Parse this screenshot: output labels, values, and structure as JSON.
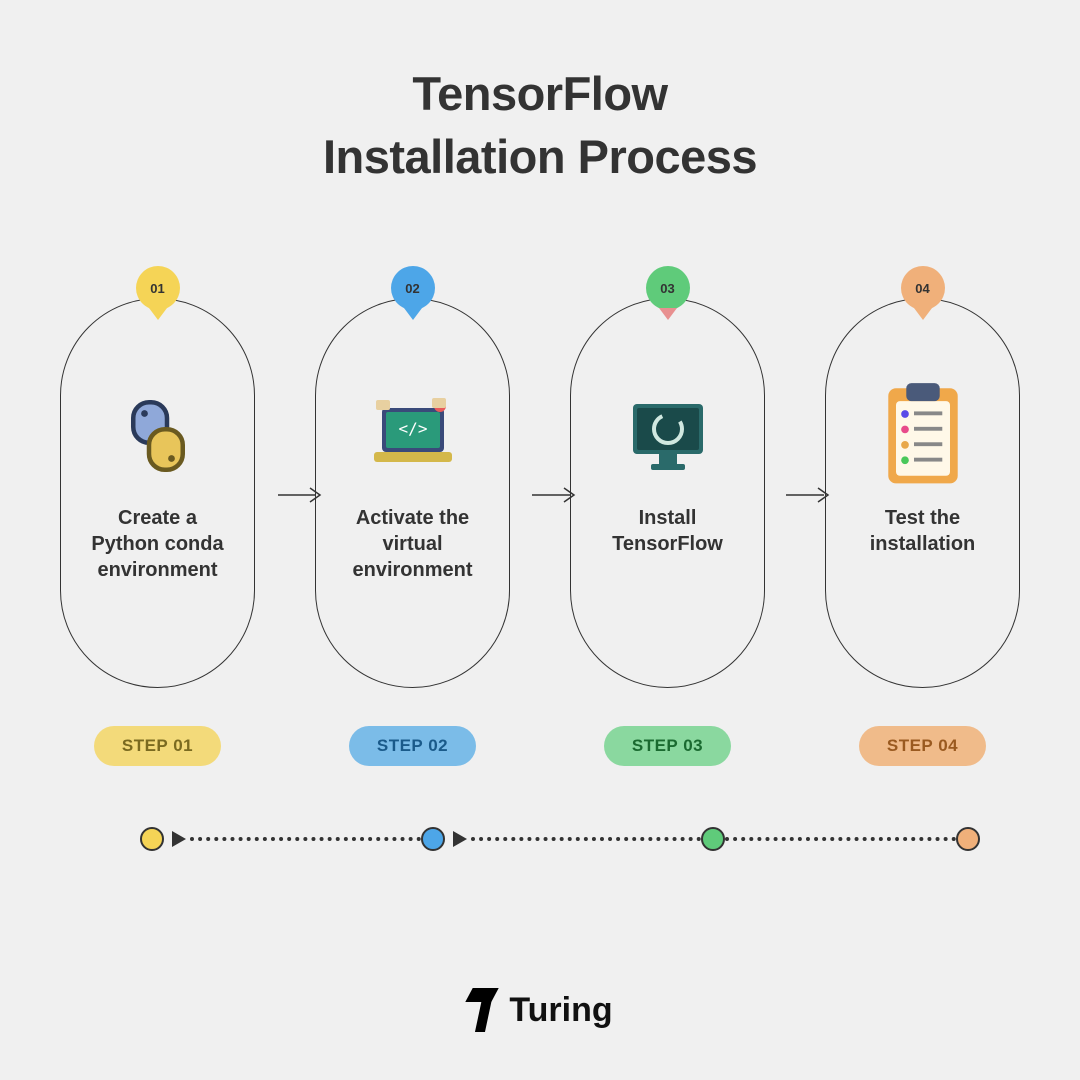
{
  "title_line1": "TensorFlow",
  "title_line2": "Installation Process",
  "steps": [
    {
      "num": "01",
      "label": "Create a\nPython conda\nenvironment",
      "pill": "STEP 01",
      "icon": "python-icon"
    },
    {
      "num": "02",
      "label": "Activate the\nvirtual\nenvironment",
      "pill": "STEP 02",
      "icon": "laptop-code-icon"
    },
    {
      "num": "03",
      "label": "Install\nTensorFlow",
      "pill": "STEP 03",
      "icon": "monitor-spinner-icon"
    },
    {
      "num": "04",
      "label": "Test the\ninstallation",
      "pill": "STEP 04",
      "icon": "checklist-icon"
    }
  ],
  "brand": "Turing",
  "colors": {
    "c1": "#f5d456",
    "c2": "#4da6e8",
    "c3": "#5fcb7a",
    "c4": "#f0b07a"
  }
}
